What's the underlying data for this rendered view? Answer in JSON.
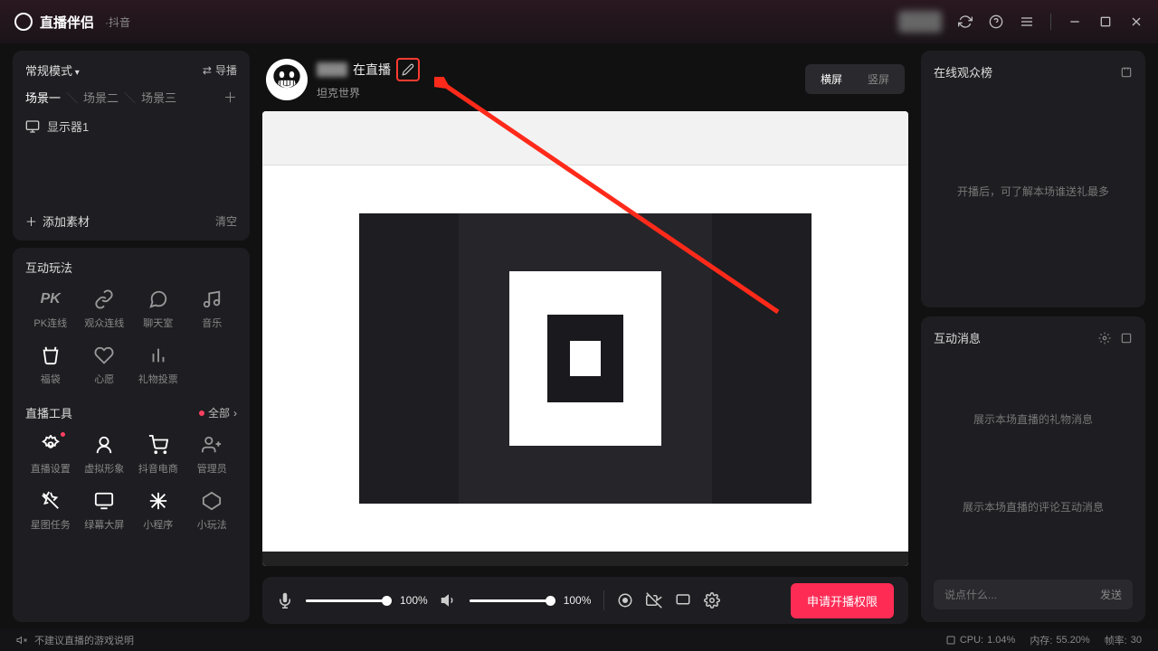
{
  "titlebar": {
    "app_name": "直播伴侣",
    "sub": "·抖音"
  },
  "sidebar": {
    "mode": "常规模式",
    "director": "导播",
    "scenes": [
      "场景一",
      "场景二",
      "场景三"
    ],
    "source_monitor": "显示器1",
    "add_source": "添加素材",
    "clear": "清空",
    "interactive_title": "互动玩法",
    "interactive": [
      {
        "label": "PK连线"
      },
      {
        "label": "观众连线"
      },
      {
        "label": "聊天室"
      },
      {
        "label": "音乐"
      },
      {
        "label": "福袋"
      },
      {
        "label": "心愿"
      },
      {
        "label": "礼物投票"
      }
    ],
    "tools_title": "直播工具",
    "tools_all": "全部",
    "tools": [
      {
        "label": "直播设置"
      },
      {
        "label": "虚拟形象"
      },
      {
        "label": "抖音电商"
      },
      {
        "label": "管理员"
      },
      {
        "label": "星图任务"
      },
      {
        "label": "绿幕大屏"
      },
      {
        "label": "小程序"
      },
      {
        "label": "小玩法"
      }
    ]
  },
  "header": {
    "live_suffix": "在直播",
    "category": "坦克世界",
    "orient_h": "横屏",
    "orient_v": "竖屏"
  },
  "controls": {
    "mic_pct": "100%",
    "spk_pct": "100%",
    "start": "申请开播权限"
  },
  "right": {
    "audience_title": "在线观众榜",
    "audience_placeholder": "开播后，可了解本场谁送礼最多",
    "msg_title": "互动消息",
    "msg_gift": "展示本场直播的礼物消息",
    "msg_comment": "展示本场直播的评论互动消息",
    "chat_placeholder": "说点什么...",
    "chat_send": "发送"
  },
  "status": {
    "warn": "不建议直播的游戏说明",
    "cpu_label": "CPU:",
    "cpu": "1.04%",
    "mem_label": "内存:",
    "mem": "55.20%",
    "fps_label": "帧率:",
    "fps": "30"
  }
}
